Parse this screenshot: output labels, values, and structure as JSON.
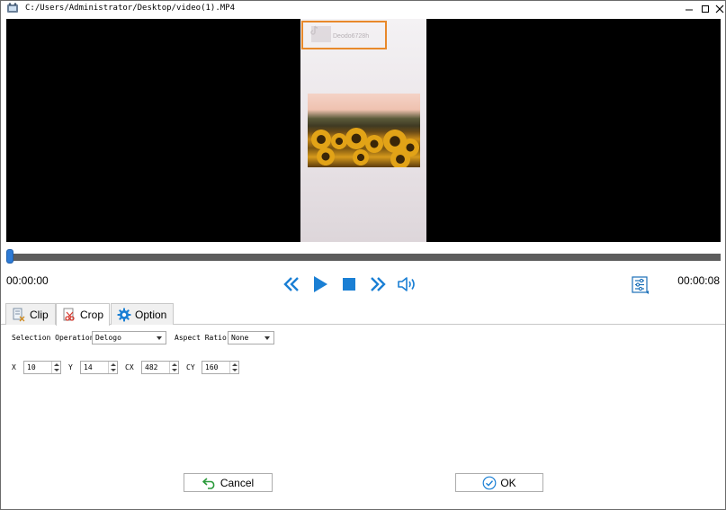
{
  "window": {
    "title": "C:/Users/Administrator/Desktop/video(1).MP4",
    "controls": {
      "minimize": "minimize-icon",
      "maximize": "maximize-icon",
      "close": "close-icon"
    }
  },
  "video": {
    "watermark_text": "Deodo6728h",
    "selection_color": "#e8892b"
  },
  "timeline": {
    "progress": 0.0,
    "accent": "#2e7bd6"
  },
  "playback": {
    "current_time": "00:00:00",
    "total_time": "00:00:08",
    "buttons": [
      "rewind-icon",
      "play-icon",
      "stop-icon",
      "fast-forward-icon",
      "volume-icon"
    ]
  },
  "tabs": [
    {
      "label": "Clip",
      "icon": "clip-icon",
      "active": false
    },
    {
      "label": "Crop",
      "icon": "crop-icon",
      "active": true
    },
    {
      "label": "Option",
      "icon": "gear-icon",
      "active": false
    }
  ],
  "crop": {
    "selection_operation_label": "Selection Operation",
    "selection_operation_value": "Delogo",
    "aspect_ratio_label": "Aspect Ratio",
    "aspect_ratio_value": "None",
    "x_label": "X",
    "x_value": "10",
    "y_label": "Y",
    "y_value": "14",
    "cx_label": "CX",
    "cx_value": "482",
    "cy_label": "CY",
    "cy_value": "160"
  },
  "footer": {
    "cancel_label": "Cancel",
    "ok_label": "OK"
  }
}
